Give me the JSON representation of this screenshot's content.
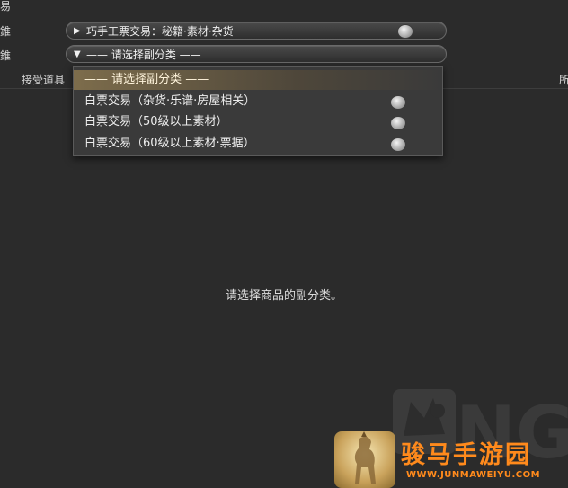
{
  "left_edge": {
    "label_1": "易",
    "label_2": "錐",
    "label_3": "錐"
  },
  "right_edge": {
    "label": "所"
  },
  "category_selector": {
    "text": "巧手工票交易：秘籍·素材·杂货"
  },
  "subcategory_selector": {
    "text": "—— 请选择副分类 ——"
  },
  "toolbar": {
    "receive_items_label": "接受道具"
  },
  "dropdown": {
    "items": [
      {
        "label": "—— 请选择副分类 ——"
      },
      {
        "label": "白票交易（杂货·乐谱·房屋相关）"
      },
      {
        "label": "白票交易（50级以上素材）"
      },
      {
        "label": "白票交易（60级以上素材·票据）"
      }
    ]
  },
  "main": {
    "empty_message": "请选择商品的副分类。"
  },
  "watermark": {
    "logo_text": "NGA"
  },
  "ad": {
    "title": "骏马手游园",
    "url": "WWW.JUNMAWEIYU.COM"
  },
  "colors": {
    "background": "#2b2b2b",
    "highlight": "#b4965a",
    "ad_orange": "#ff8a1c"
  },
  "icons": {
    "currency": "scrip-coin-icon",
    "expand": "triangle-right-icon",
    "collapse": "triangle-down-icon"
  }
}
